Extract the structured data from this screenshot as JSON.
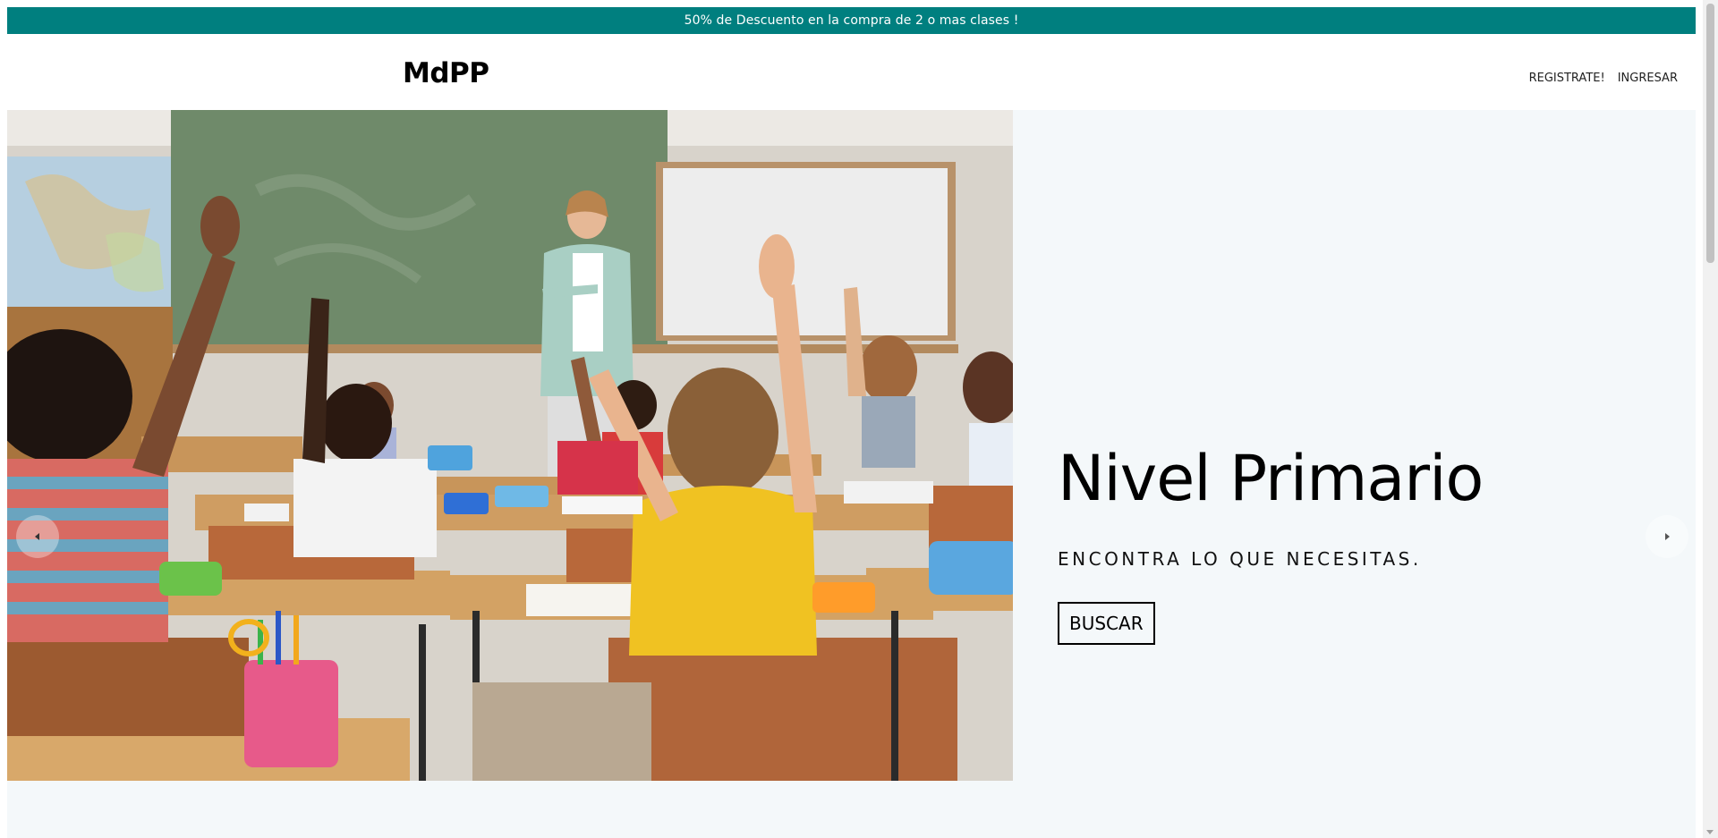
{
  "announcement": {
    "text": "50% de Descuento en la compra de 2 o mas clases !",
    "background": "#007f7f"
  },
  "header": {
    "logo": "MdPP",
    "nav": {
      "register": "REGISTRATE!",
      "login": "INGRESAR"
    }
  },
  "hero": {
    "image_alt": "Aula con alumnos levantando la mano",
    "title": "Nivel Primario",
    "subtitle": "ENCONTRA LO QUE NECESITAS.",
    "button": "BUSCAR",
    "background": "#f4f8fa",
    "prev_icon": "chevron-left-icon",
    "next_icon": "chevron-right-icon"
  },
  "colors": {
    "accent": "#007f7f",
    "text": "#000000"
  }
}
